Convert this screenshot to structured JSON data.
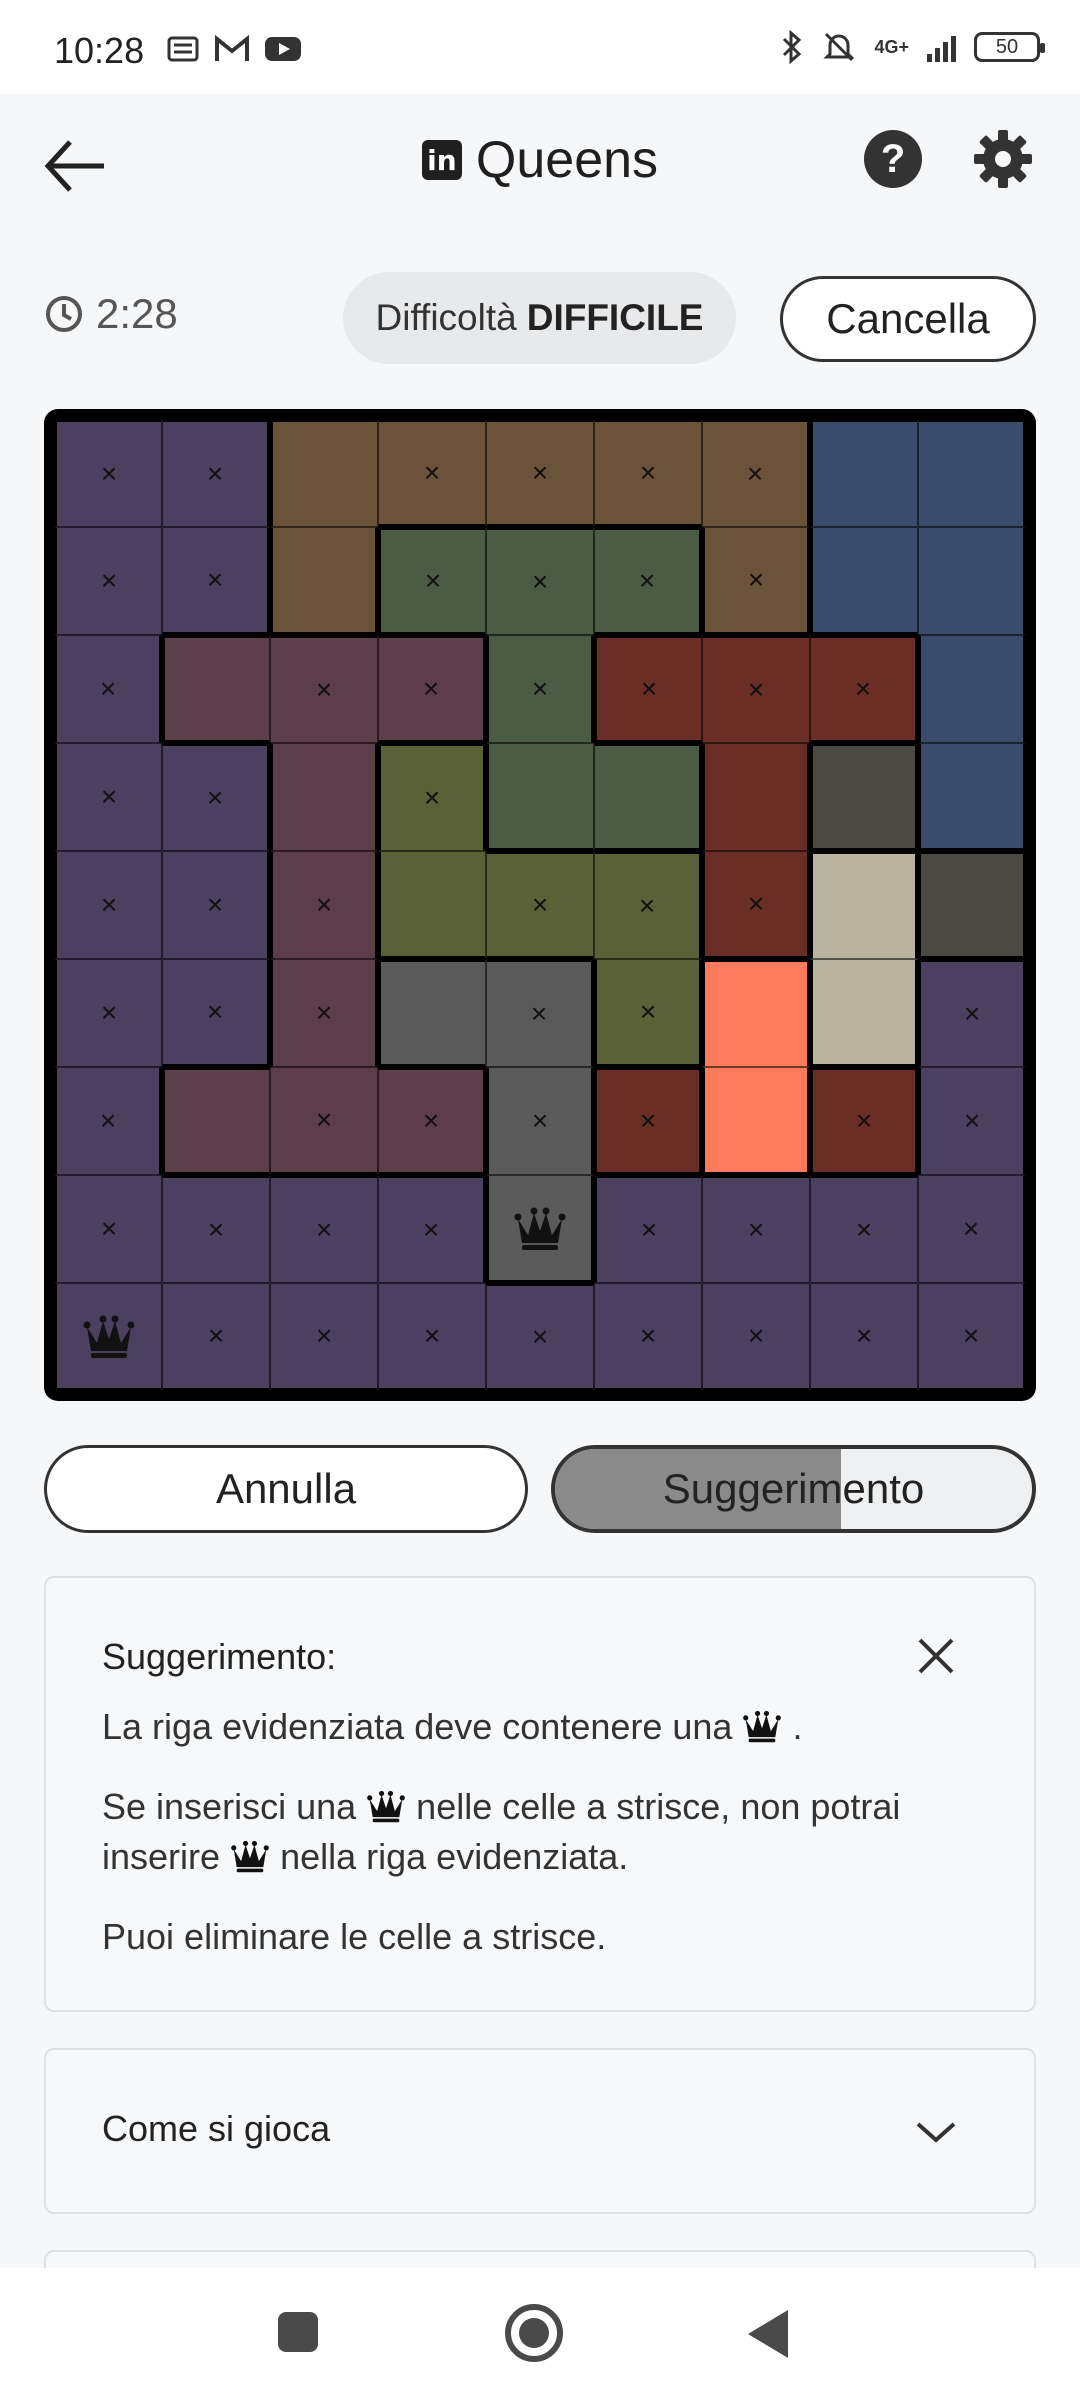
{
  "status_bar": {
    "time": "10:28",
    "left_icons": [
      "sim-card-icon",
      "gmail-icon",
      "youtube-icon"
    ],
    "right_icons": [
      "bluetooth-icon",
      "mute-icon",
      "network-4g-icon",
      "signal-icon"
    ],
    "network": "4G+",
    "battery": "50"
  },
  "header": {
    "title": "Queens",
    "logo_text": "in",
    "back_icon": "arrow-left-icon",
    "help_icon": "question-mark-icon",
    "settings_icon": "gear-icon"
  },
  "info": {
    "timer": "2:28",
    "difficulty_label": "Difficoltà",
    "difficulty_value": "DIFFICILE",
    "cancel_label": "Cancella"
  },
  "board": {
    "size": 9,
    "colors": {
      "A": "#4b4060",
      "B": "#6b5339",
      "C": "#3b4b6b",
      "D": "#5c3d4a",
      "E": "#4a5c43",
      "F": "#6a2e26",
      "G": "#5b6137",
      "H": "#4a4842",
      "I": "#5a5a5a",
      "J": "#b9b3a0",
      "K": "#ff7b5e"
    },
    "regions": [
      "AABBBBBCC",
      "AABEEEBCC",
      "ADDDEFFFC",
      "AADGEEFHC",
      "AADGGGFJH",
      "AADIIGKJA",
      "ADDDIFKFA",
      "AAAAIAAAA",
      "AAAAAAAAA"
    ],
    "cells": [
      "xx.xxxx..",
      "xx.xxxx..",
      "x.xxxxxx.",
      "xx.x.....",
      "xxx.xxxS.",
      "xxx.xx..x",
      "x.xxxxSxx",
      "xxxxQxxxx",
      "Qxxxxxxxx"
    ]
  },
  "actions": {
    "undo_label": "Annulla",
    "hint_label": "Suggerimento",
    "hint_progress": 0.6
  },
  "hint_card": {
    "title": "Suggerimento:",
    "close_icon": "close-icon",
    "line1_a": "La riga evidenziata deve contenere una",
    "line1_b": ".",
    "line2_a": "Se inserisci una",
    "line2_b": "nelle celle a strisce, non potrai inserire",
    "line2_c": "nella riga evidenziata.",
    "line3": "Puoi eliminare le celle a strisce."
  },
  "how_to_play": {
    "title": "Come si gioca",
    "chevron_icon": "chevron-down-icon"
  },
  "nav_bar": {
    "icons": [
      "recents-square-icon",
      "home-circle-icon",
      "back-triangle-icon"
    ]
  }
}
